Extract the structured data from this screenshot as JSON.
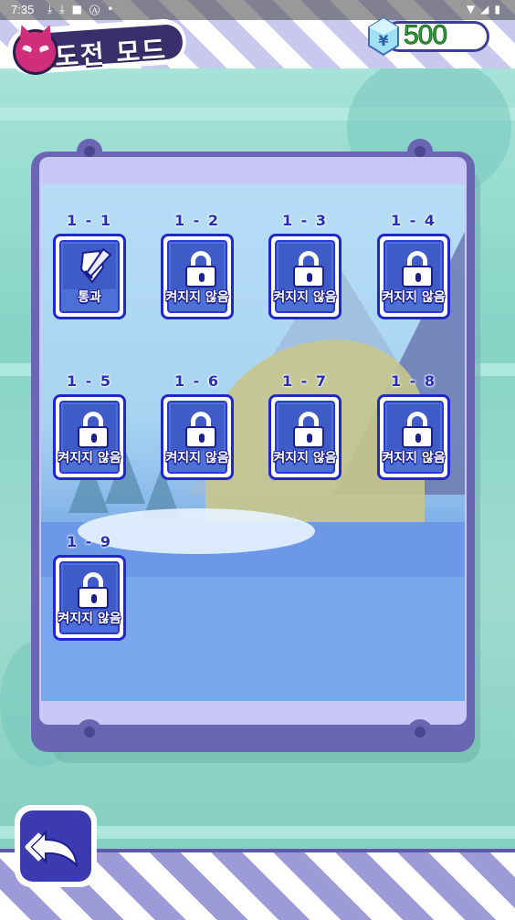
{
  "status_bar": {
    "time": "7:35",
    "left_icons": [
      "download-icon",
      "download-icon",
      "square-app-icon",
      "a-app-icon",
      "dot-icon"
    ],
    "right_icons": [
      "wifi-icon",
      "signal-icon",
      "battery-icon"
    ]
  },
  "header": {
    "title": "도전 모드",
    "mascot_icon": "devil-icon",
    "currency": {
      "icon": "gem-icon",
      "amount": "500"
    }
  },
  "levels": [
    {
      "number": "1 - 1",
      "status": "통과",
      "icon": "sword-shield-icon",
      "locked": false
    },
    {
      "number": "1 - 2",
      "status": "켜지지 않음",
      "icon": "lock-icon",
      "locked": true
    },
    {
      "number": "1 - 3",
      "status": "켜지지 않음",
      "icon": "lock-icon",
      "locked": true
    },
    {
      "number": "1 - 4",
      "status": "켜지지 않음",
      "icon": "lock-icon",
      "locked": true
    },
    {
      "number": "1 - 5",
      "status": "켜지지 않음",
      "icon": "lock-icon",
      "locked": true
    },
    {
      "number": "1 - 6",
      "status": "켜지지 않음",
      "icon": "lock-icon",
      "locked": true
    },
    {
      "number": "1 - 7",
      "status": "켜지지 않음",
      "icon": "lock-icon",
      "locked": true
    },
    {
      "number": "1 - 8",
      "status": "켜지지 않음",
      "icon": "lock-icon",
      "locked": true
    },
    {
      "number": "1 - 9",
      "status": "켜지지 않음",
      "icon": "lock-icon",
      "locked": true
    }
  ],
  "back_button": {
    "icon": "back-arrow-icon"
  },
  "colors": {
    "board": "#6a66b3",
    "tile_border": "#2028c7",
    "tile_face": "#4c6fd8",
    "currency_text": "#2f9d3a",
    "back_button": "#3b3ab0"
  }
}
